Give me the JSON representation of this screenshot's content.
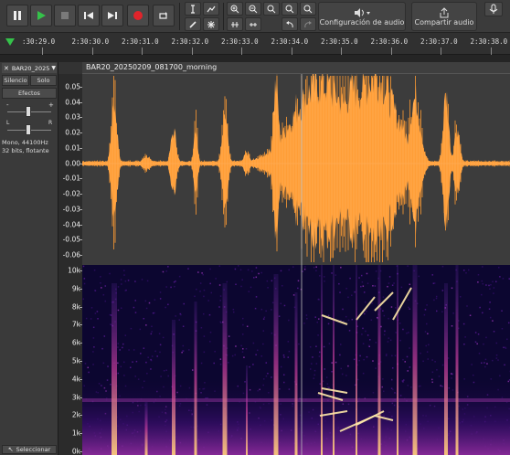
{
  "toolbar": {
    "pause_icon": "pause-icon",
    "play_icon": "play-icon",
    "stop_icon": "stop-icon",
    "skip_start_icon": "skip-to-start-icon",
    "skip_end_icon": "skip-to-end-icon",
    "record_icon": "record-icon",
    "loop_icon": "loop-icon",
    "audio_setup_label": "Configuración de audio",
    "share_audio_label": "Compartir audio"
  },
  "ruler": {
    "ticks": [
      ":30:29.0",
      "2:30:30.0",
      "2:30:31.0",
      "2:30:32.0",
      "2:30:33.0",
      "2:30:34.0",
      "2:30:35.0",
      "2:30:36.0",
      "2:30:37.0",
      "2:30:38.0"
    ]
  },
  "track": {
    "name": "BAR20_2025",
    "mute_label": "Silencio",
    "solo_label": "Solo",
    "effects_label": "Efectos",
    "gain_minus": "-",
    "gain_plus": "+",
    "pan_left": "L",
    "pan_right": "R",
    "info_line1": "Mono, 44100Hz",
    "info_line2": "32 bits, flotante",
    "select_label": "Seleccionar"
  },
  "clip": {
    "title": "BAR20_20250209_081700_morning"
  },
  "wave_scale": [
    "0.05",
    "0.04",
    "0.03",
    "0.02",
    "0.01",
    "0.00",
    "-0.01",
    "-0.02",
    "-0.03",
    "-0.04",
    "-0.05",
    "-0.06"
  ],
  "spec_scale": [
    "10k",
    "9k",
    "8k",
    "7k",
    "6k",
    "5k",
    "4k",
    "3k",
    "2k",
    "1k",
    "0k"
  ],
  "colors": {
    "waveform": "#ffa94d",
    "waveform_dark": "#ff9b33",
    "spectrogram_bg": "#0c0630",
    "accent_green": "#35c24a",
    "record_red": "#e0242b"
  }
}
